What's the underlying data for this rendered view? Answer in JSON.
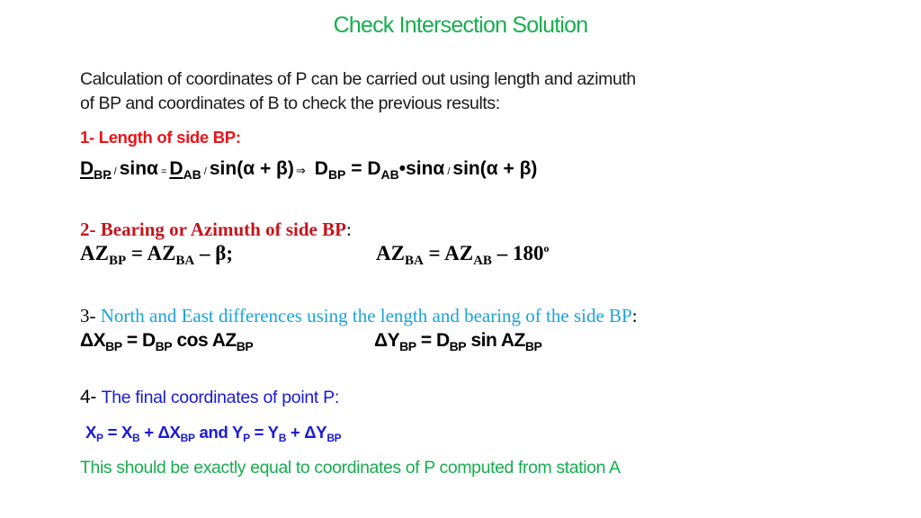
{
  "title": "Check Intersection Solution",
  "intro": {
    "line1": "Calculation of coordinates of P can be carried out using length and azimuth",
    "line2": "of BP and coordinates of B to check the previous results:"
  },
  "colors": {
    "title": "#17ae4f",
    "section1_heading": "#e8141a",
    "section2_heading": "#c0161e",
    "section3_heading": "#1aa3d9",
    "section4": "#1a1ad6",
    "closing": "#17ae4f"
  },
  "section1": {
    "heading": "1- Length of side BP:",
    "equation": {
      "d": "D",
      "bp": "BP",
      "ab": "AB",
      "slash": "/",
      "sin_alpha": "sinα",
      "equals_small": "=",
      "sin_alpha_beta": "sin(α + β)",
      "implies": "⇒",
      "equals": " = ",
      "bullet": "•"
    }
  },
  "section2": {
    "heading": "2- Bearing or Azimuth of side BP",
    "colon": ":",
    "eq1": {
      "az": "AZ",
      "sub1": "BP",
      "mid": " = AZ",
      "sub2": "BA",
      "tail": " – β;"
    },
    "eq2": {
      "az": "AZ",
      "sub1": "BA",
      "mid": " = AZ",
      "sub2": "AB",
      "tail": " – 180",
      "degree": "o"
    }
  },
  "section3": {
    "number": "3- ",
    "heading": "North and East differences using the length and bearing of the side BP",
    "colon": ":",
    "eq1": {
      "lhs": "ΔX",
      "sub": "BP",
      "mid": " = D",
      "func": " cos AZ"
    },
    "eq2": {
      "lhs": "ΔY",
      "sub": "BP",
      "mid": " = D",
      "func": " sin AZ"
    }
  },
  "section4": {
    "number": "4- ",
    "heading": "The final coordinates of point P:",
    "equation": {
      "x": "X",
      "y": "Y",
      "p": "P",
      "b": "B",
      "bp": "BP",
      "eq": " = ",
      "plus_dx": " + ΔX",
      "plus_dy": " + ΔY",
      "and": " and "
    }
  },
  "closing": "This should be exactly equal to coordinates of P computed from station A"
}
